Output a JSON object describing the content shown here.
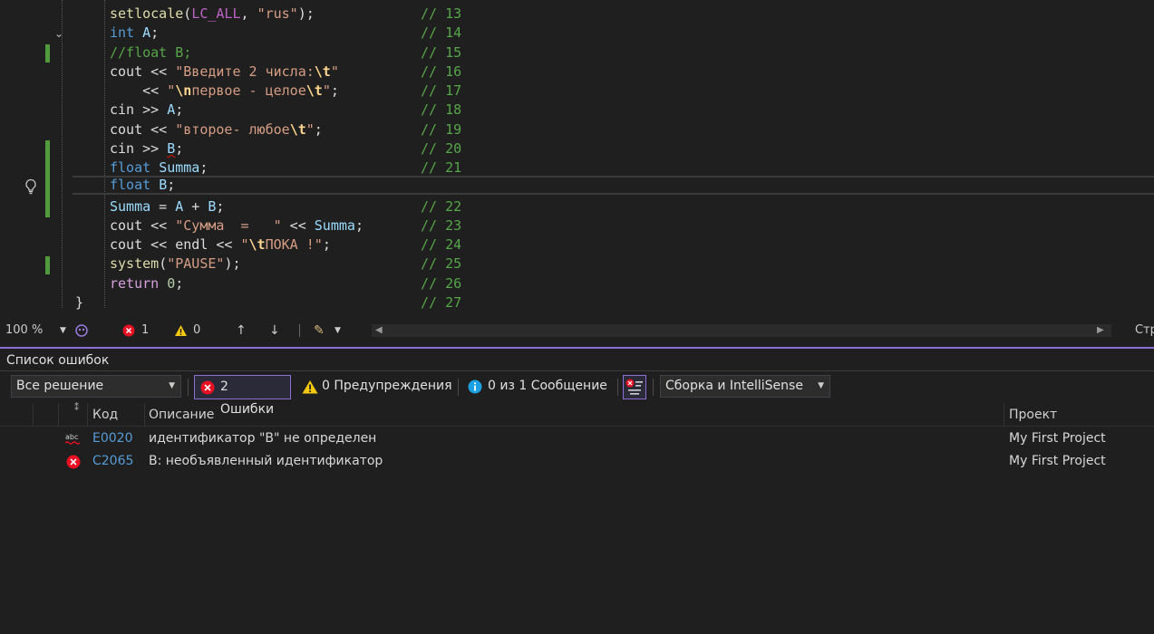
{
  "editor": {
    "lines": [
      {
        "text_parts": [
          [
            "t-fn",
            "setlocale"
          ],
          [
            "t-plain",
            "("
          ],
          [
            "t-macro",
            "LC_ALL"
          ],
          [
            "t-plain",
            ", "
          ],
          [
            "t-str",
            "\"rus\""
          ],
          [
            "t-plain",
            ");"
          ]
        ],
        "comment": "// 13"
      },
      {
        "text_parts": [
          [
            "t-kw",
            "int"
          ],
          [
            "t-plain",
            " "
          ],
          [
            "t-var",
            "A"
          ],
          [
            "t-plain",
            ";"
          ]
        ],
        "comment": "// 14"
      },
      {
        "text_parts": [
          [
            "t-comment-green",
            "//float B;"
          ]
        ],
        "comment": "// 15"
      },
      {
        "text_parts": [
          [
            "t-plain",
            "cout << "
          ],
          [
            "t-str",
            "\"Введите 2 числа:"
          ],
          [
            "t-bold-esc",
            "\\t"
          ],
          [
            "t-str",
            "\""
          ]
        ],
        "comment": "// 16"
      },
      {
        "text_parts": [
          [
            "t-plain",
            "    << "
          ],
          [
            "t-str",
            "\""
          ],
          [
            "t-bold-esc",
            "\\n"
          ],
          [
            "t-str",
            "первое - целое"
          ],
          [
            "t-bold-esc",
            "\\t"
          ],
          [
            "t-str",
            "\""
          ],
          [
            "t-plain",
            ";"
          ]
        ],
        "comment": "// 17"
      },
      {
        "text_parts": [
          [
            "t-plain",
            "cin >> "
          ],
          [
            "t-var",
            "A"
          ],
          [
            "t-plain",
            ";"
          ]
        ],
        "comment": "// 18"
      },
      {
        "text_parts": [
          [
            "t-plain",
            "cout << "
          ],
          [
            "t-str",
            "\"второе- любое"
          ],
          [
            "t-bold-esc",
            "\\t"
          ],
          [
            "t-str",
            "\""
          ],
          [
            "t-plain",
            ";"
          ]
        ],
        "comment": "// 19"
      },
      {
        "text_parts": [
          [
            "t-plain",
            "cin >> "
          ],
          [
            "t-var squig",
            "B"
          ],
          [
            "t-plain",
            ";"
          ]
        ],
        "comment": "// 20"
      },
      {
        "text_parts": [
          [
            "t-kw",
            "float"
          ],
          [
            "t-plain",
            " "
          ],
          [
            "t-var",
            "Summa"
          ],
          [
            "t-plain",
            ";"
          ]
        ],
        "comment": "// 21"
      },
      {
        "text_parts": [
          [
            "t-kw",
            "float"
          ],
          [
            "t-plain",
            " "
          ],
          [
            "t-var",
            "B"
          ],
          [
            "t-plain",
            ";"
          ]
        ],
        "comment": ""
      },
      {
        "text_parts": [
          [
            "t-var",
            "Summa"
          ],
          [
            "t-plain",
            " = "
          ],
          [
            "t-var",
            "A"
          ],
          [
            "t-plain",
            " + "
          ],
          [
            "t-var",
            "B"
          ],
          [
            "t-plain",
            ";"
          ]
        ],
        "comment": "// 22"
      },
      {
        "text_parts": [
          [
            "t-plain",
            "cout << "
          ],
          [
            "t-str",
            "\"Сумма  =   \""
          ],
          [
            "t-plain",
            " << "
          ],
          [
            "t-var",
            "Summa"
          ],
          [
            "t-plain",
            ";"
          ]
        ],
        "comment": "// 23"
      },
      {
        "text_parts": [
          [
            "t-plain",
            "cout << endl << "
          ],
          [
            "t-str",
            "\""
          ],
          [
            "t-bold-esc",
            "\\t"
          ],
          [
            "t-str",
            "ПОКА !\""
          ],
          [
            "t-plain",
            ";"
          ]
        ],
        "comment": "// 24"
      },
      {
        "text_parts": [
          [
            "t-fn",
            "system"
          ],
          [
            "t-plain",
            "("
          ],
          [
            "t-str",
            "\"PAUSE\""
          ],
          [
            "t-plain",
            ");"
          ]
        ],
        "comment": "// 25"
      },
      {
        "text_parts": [
          [
            "t-kw2",
            "return"
          ],
          [
            "t-plain",
            " "
          ],
          [
            "t-num",
            "0"
          ],
          [
            "t-plain",
            ";"
          ]
        ],
        "comment": "// 26"
      },
      {
        "text_parts": [
          [
            "t-plain",
            "}"
          ]
        ],
        "comment": "// 27"
      }
    ]
  },
  "status": {
    "zoom": "100 %",
    "errors": "1",
    "warnings": "0",
    "right_label": "Стр"
  },
  "panel": {
    "title": "Список ошибок",
    "scope": "Все решение",
    "errors_btn": "2 Ошибки",
    "warnings_btn": "0 Предупреждения",
    "messages_btn": "0 из 1 Сообщение",
    "source": "Сборка и IntelliSense",
    "columns": {
      "code": "Код",
      "description": "Описание",
      "project": "Проект"
    },
    "rows": [
      {
        "icon": "spelling-error-icon",
        "code": "E0020",
        "description": "идентификатор \"B\" не определен",
        "project": "My First Project"
      },
      {
        "icon": "error-icon",
        "code": "C2065",
        "description": "B: необъявленный идентификатор",
        "project": "My First Project"
      }
    ]
  },
  "colors": {
    "accent": "#8e6fd6",
    "error": "#e81123",
    "warning": "#f2c811",
    "info": "#1ba1e2",
    "change_bar": "#4e9a3c"
  }
}
